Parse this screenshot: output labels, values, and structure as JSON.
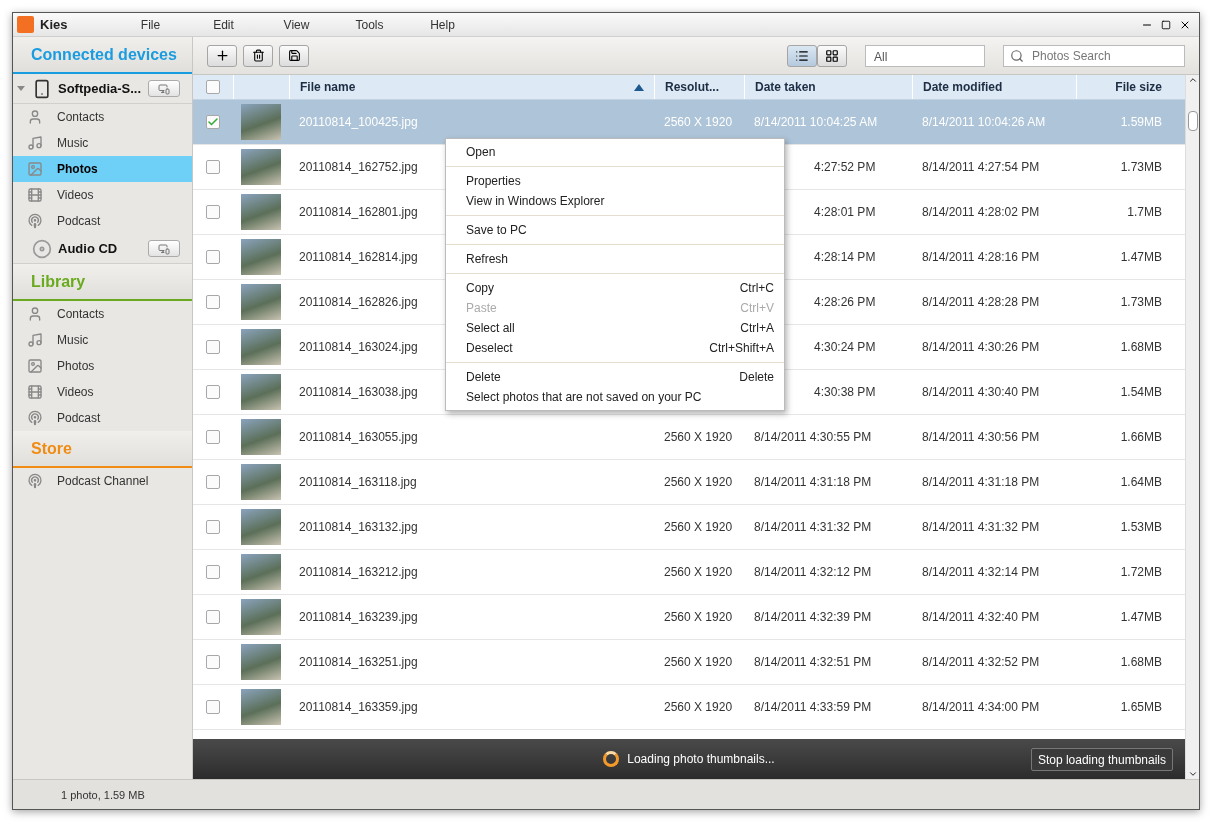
{
  "window": {
    "app_name": "Kies"
  },
  "menu": [
    "File",
    "Edit",
    "View",
    "Tools",
    "Help"
  ],
  "sidebar": {
    "sections": [
      {
        "title": "Connected devices",
        "color": "#1a9ce0",
        "groups": [
          {
            "kind": "phone",
            "name": "Softpedia-S...",
            "expanded": true,
            "items": [
              {
                "label": "Contacts",
                "kind": "contacts",
                "selected": false
              },
              {
                "label": "Music",
                "kind": "music",
                "selected": false
              },
              {
                "label": "Photos",
                "kind": "photos",
                "selected": true
              },
              {
                "label": "Videos",
                "kind": "videos",
                "selected": false
              },
              {
                "label": "Podcast",
                "kind": "podcast",
                "selected": false
              }
            ]
          },
          {
            "kind": "cd",
            "name": "Audio CD",
            "expanded": false
          }
        ]
      },
      {
        "title": "Library",
        "color": "#6aaa1e",
        "groups": [
          {
            "kind": "none",
            "items": [
              {
                "label": "Contacts",
                "kind": "contacts",
                "selected": false
              },
              {
                "label": "Music",
                "kind": "music",
                "selected": false
              },
              {
                "label": "Photos",
                "kind": "photos",
                "selected": false
              },
              {
                "label": "Videos",
                "kind": "videos",
                "selected": false
              },
              {
                "label": "Podcast",
                "kind": "podcast",
                "selected": false
              }
            ]
          }
        ]
      },
      {
        "title": "Store",
        "color": "#f08c14",
        "groups": [
          {
            "kind": "none",
            "items": [
              {
                "label": "Podcast Channel",
                "kind": "podcast",
                "selected": false
              }
            ]
          }
        ]
      }
    ]
  },
  "toolbar": {
    "view_modes": [
      {
        "kind": "list",
        "selected": true
      },
      {
        "kind": "grid",
        "selected": false
      }
    ],
    "filter": {
      "value": "All"
    },
    "search": {
      "placeholder": "Photos Search"
    }
  },
  "table": {
    "all_checked": false,
    "columns": [
      {
        "label": "File name",
        "sorted": true
      },
      {
        "label": "Resolut...",
        "sorted": false
      },
      {
        "label": "Date taken",
        "sorted": false
      },
      {
        "label": "Date modified",
        "sorted": false
      },
      {
        "label": "File size",
        "sorted": false
      }
    ],
    "rows": [
      {
        "selected": true,
        "checked": true,
        "covered": false,
        "file_name": "20110814_100425.jpg",
        "resolution": "2560 X 1920",
        "date_taken": "8/14/2011 10:04:25 AM",
        "date_modified": "8/14/2011 10:04:26 AM",
        "file_size": "1.59MB"
      },
      {
        "selected": false,
        "checked": false,
        "covered": true,
        "file_name": "20110814_162752.jpg",
        "date_taken": "4:27:52 PM",
        "date_modified": "8/14/2011 4:27:54 PM",
        "file_size": "1.73MB"
      },
      {
        "selected": false,
        "checked": false,
        "covered": true,
        "file_name": "20110814_162801.jpg",
        "date_taken": "4:28:01 PM",
        "date_modified": "8/14/2011 4:28:02 PM",
        "file_size": "1.7MB"
      },
      {
        "selected": false,
        "checked": false,
        "covered": true,
        "file_name": "20110814_162814.jpg",
        "date_taken": "4:28:14 PM",
        "date_modified": "8/14/2011 4:28:16 PM",
        "file_size": "1.47MB"
      },
      {
        "selected": false,
        "checked": false,
        "covered": true,
        "file_name": "20110814_162826.jpg",
        "date_taken": "4:28:26 PM",
        "date_modified": "8/14/2011 4:28:28 PM",
        "file_size": "1.73MB"
      },
      {
        "selected": false,
        "checked": false,
        "covered": true,
        "file_name": "20110814_163024.jpg",
        "date_taken": "4:30:24 PM",
        "date_modified": "8/14/2011 4:30:26 PM",
        "file_size": "1.68MB"
      },
      {
        "selected": false,
        "checked": false,
        "covered": true,
        "file_name": "20110814_163038.jpg",
        "date_taken": "4:30:38 PM",
        "date_modified": "8/14/2011 4:30:40 PM",
        "file_size": "1.54MB"
      },
      {
        "selected": false,
        "checked": false,
        "covered": false,
        "file_name": "20110814_163055.jpg",
        "resolution": "2560 X 1920",
        "date_taken": "8/14/2011 4:30:55 PM",
        "date_modified": "8/14/2011 4:30:56 PM",
        "file_size": "1.66MB"
      },
      {
        "selected": false,
        "checked": false,
        "covered": false,
        "file_name": "20110814_163118.jpg",
        "resolution": "2560 X 1920",
        "date_taken": "8/14/2011 4:31:18 PM",
        "date_modified": "8/14/2011 4:31:18 PM",
        "file_size": "1.64MB"
      },
      {
        "selected": false,
        "checked": false,
        "covered": false,
        "file_name": "20110814_163132.jpg",
        "resolution": "2560 X 1920",
        "date_taken": "8/14/2011 4:31:32 PM",
        "date_modified": "8/14/2011 4:31:32 PM",
        "file_size": "1.53MB"
      },
      {
        "selected": false,
        "checked": false,
        "covered": false,
        "file_name": "20110814_163212.jpg",
        "resolution": "2560 X 1920",
        "date_taken": "8/14/2011 4:32:12 PM",
        "date_modified": "8/14/2011 4:32:14 PM",
        "file_size": "1.72MB"
      },
      {
        "selected": false,
        "checked": false,
        "covered": false,
        "file_name": "20110814_163239.jpg",
        "resolution": "2560 X 1920",
        "date_taken": "8/14/2011 4:32:39 PM",
        "date_modified": "8/14/2011 4:32:40 PM",
        "file_size": "1.47MB"
      },
      {
        "selected": false,
        "checked": false,
        "covered": false,
        "file_name": "20110814_163251.jpg",
        "resolution": "2560 X 1920",
        "date_taken": "8/14/2011 4:32:51 PM",
        "date_modified": "8/14/2011 4:32:52 PM",
        "file_size": "1.68MB"
      },
      {
        "selected": false,
        "checked": false,
        "covered": false,
        "file_name": "20110814_163359.jpg",
        "resolution": "2560 X 1920",
        "date_taken": "8/14/2011 4:33:59 PM",
        "date_modified": "8/14/2011 4:34:00 PM",
        "file_size": "1.65MB"
      }
    ]
  },
  "context_menu": {
    "groups": [
      [
        {
          "label": "Open",
          "disabled": false
        }
      ],
      [
        {
          "label": "Properties",
          "disabled": false
        },
        {
          "label": "View in Windows Explorer",
          "disabled": false
        }
      ],
      [
        {
          "label": "Save to PC",
          "disabled": false
        }
      ],
      [
        {
          "label": "Refresh",
          "disabled": false
        }
      ],
      [
        {
          "label": "Copy",
          "shortcut": "Ctrl+C",
          "disabled": false
        },
        {
          "label": "Paste",
          "shortcut": "Ctrl+V",
          "disabled": true
        },
        {
          "label": "Select all",
          "shortcut": "Ctrl+A",
          "disabled": false
        },
        {
          "label": "Deselect",
          "shortcut": "Ctrl+Shift+A",
          "disabled": false
        }
      ],
      [
        {
          "label": "Delete",
          "shortcut": "Delete",
          "disabled": false
        },
        {
          "label": "Select photos that are not saved on your PC",
          "disabled": false
        }
      ]
    ]
  },
  "loading_bar": {
    "message": "Loading photo thumbnails...",
    "button": "Stop loading thumbnails"
  },
  "status_bar": {
    "text": "1 photo, 1.59 MB"
  }
}
